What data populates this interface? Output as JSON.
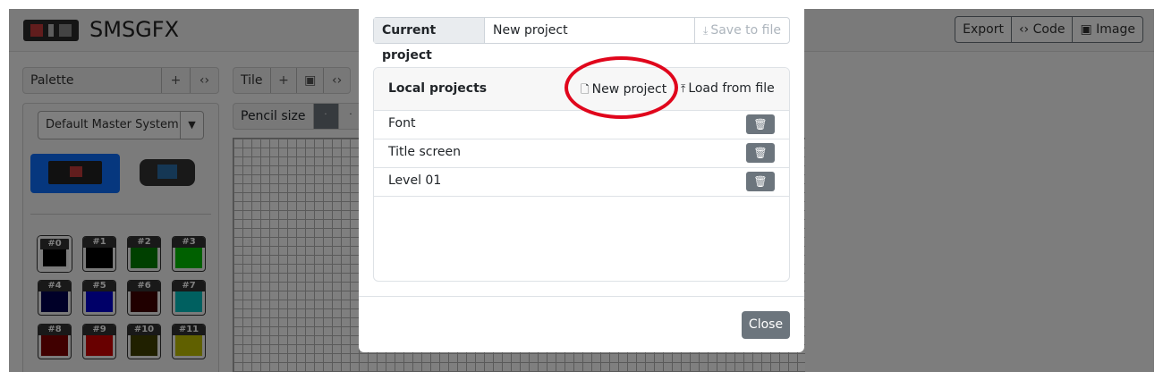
{
  "app": {
    "title": "SMSGFX"
  },
  "nav": {
    "export": "Export",
    "code": "Code",
    "image": "Image",
    "code_glyph": "‹›",
    "image_glyph": "▣"
  },
  "palette": {
    "label": "Palette",
    "add": "+",
    "code": "‹›",
    "system_select": "Default Master System",
    "swatches": [
      {
        "label": "#0",
        "color": "#000000"
      },
      {
        "label": "#1",
        "color": "#000000"
      },
      {
        "label": "#2",
        "color": "#008000"
      },
      {
        "label": "#3",
        "color": "#00c000"
      },
      {
        "label": "#4",
        "color": "#000050"
      },
      {
        "label": "#5",
        "color": "#0000d0"
      },
      {
        "label": "#6",
        "color": "#400000"
      },
      {
        "label": "#7",
        "color": "#00c0c0"
      },
      {
        "label": "#8",
        "color": "#800000"
      },
      {
        "label": "#9",
        "color": "#d00000"
      },
      {
        "label": "#10",
        "color": "#404000"
      },
      {
        "label": "#11",
        "color": "#c0c000"
      }
    ]
  },
  "tile": {
    "label": "Tile",
    "add": "+",
    "image": "▣",
    "code": "‹›"
  },
  "pencil": {
    "label": "Pencil size",
    "sizes": [
      "·",
      "·"
    ]
  },
  "modal": {
    "current_project_label": "Current project",
    "current_project_value": "New project",
    "save_to_file": "Save to file",
    "local_projects_title": "Local projects",
    "new_project": "New project",
    "load_from_file": "Load from file",
    "projects": [
      {
        "name": "Font"
      },
      {
        "name": "Title screen"
      },
      {
        "name": "Level 01"
      }
    ],
    "close": "Close"
  },
  "colors": {
    "accent": "#0d6efd",
    "secondary": "#6c757d",
    "annotation": "#e0061c"
  }
}
